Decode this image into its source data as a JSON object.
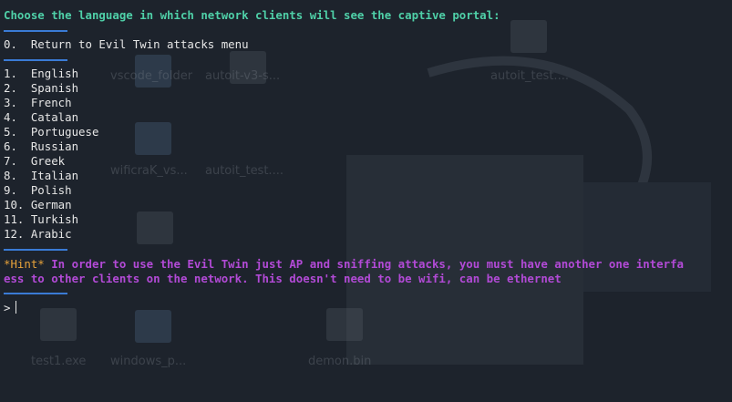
{
  "terminal": {
    "title_prompt": "Choose the language in which network clients will see the captive portal:",
    "return_option": "0.  Return to Evil Twin attacks menu",
    "languages": [
      "1.  English",
      "2.  Spanish",
      "3.  French",
      "4.  Catalan",
      "5.  Portuguese",
      "6.  Russian",
      "7.  Greek",
      "8.  Italian",
      "9.  Polish",
      "10. German",
      "11. Turkish",
      "12. Arabic"
    ],
    "hint_tag": "*Hint*",
    "hint_line1": " In order to use the Evil Twin just AP and sniffing attacks, you must have another one interfa",
    "hint_line2": "ess to other clients on the network. This doesn't need to be wifi, can be ethernet",
    "input_prompt": ">"
  },
  "desktop": {
    "icons": [
      "vscode_folder",
      "autoit-v3-s...",
      "autoit_test....",
      "wificraK_vs...",
      "autoit_test....",
      "test1.exe",
      "windows_p...",
      "demon.bin"
    ]
  },
  "colors": {
    "background": "#1d232c",
    "title_green": "#4fd0a8",
    "separator_blue": "#3a7bd5",
    "hint_orange": "#e8a33a",
    "hint_purple": "#b24ad6",
    "text": "#e6e6e6"
  }
}
